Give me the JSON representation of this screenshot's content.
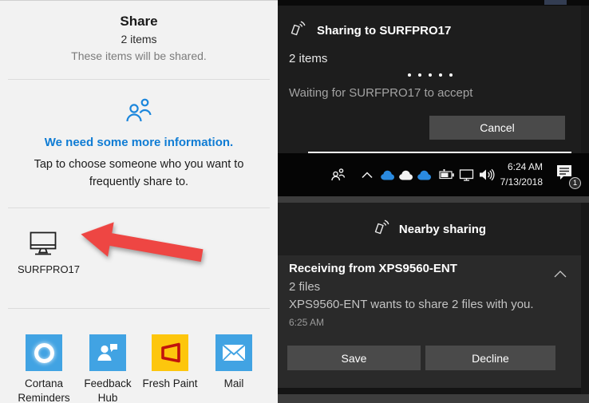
{
  "colors": {
    "accent_blue": "#0f7cd4",
    "tile_blue": "#41a3e3",
    "tile_yellow": "#fdc60d",
    "fresh_paint_red": "#c1130d",
    "arrow_red": "#ee4643",
    "button_gray": "#4a4a4a",
    "toast_dark": "#1d1d1d",
    "toast_body": "#2a2a2a"
  },
  "share_panel": {
    "title": "Share",
    "item_count": "2 items",
    "note": "These items will be shared.",
    "info_heading": "We need some more information.",
    "info_body": "Tap to choose someone who you want to frequently share to.",
    "device_name": "SURFPRO17",
    "apps": [
      {
        "label": "Cortana Reminders"
      },
      {
        "label": "Feedback Hub"
      },
      {
        "label": "Fresh Paint"
      },
      {
        "label": "Mail"
      }
    ]
  },
  "sharing_toast": {
    "title": "Sharing to SURFPRO17",
    "item_count": "2 items",
    "status": "Waiting for SURFPRO17 to accept",
    "cancel_label": "Cancel"
  },
  "taskbar": {
    "time": "6:24 AM",
    "date": "7/13/2018",
    "notification_count": "1"
  },
  "nearby_toast": {
    "header": "Nearby sharing",
    "title": "Receiving from XPS9560-ENT",
    "file_count": "2 files",
    "message": "XPS9560-ENT wants to share 2 files with you.",
    "time": "6:25 AM",
    "save_label": "Save",
    "decline_label": "Decline"
  }
}
